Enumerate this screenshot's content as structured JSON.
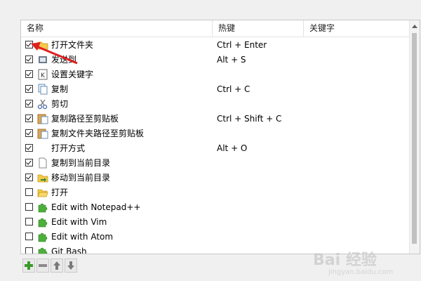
{
  "table": {
    "columns": [
      "名称",
      "热键",
      "关键字"
    ],
    "rows": [
      {
        "name": "打开文件夹",
        "hotkey": "Ctrl + Enter",
        "checked": true,
        "icon": "folder-icon"
      },
      {
        "name": "发送到",
        "hotkey": "Alt + S",
        "checked": true,
        "icon": "send-to-icon"
      },
      {
        "name": "设置关键字",
        "hotkey": "",
        "checked": true,
        "icon": "keyword-icon"
      },
      {
        "name": "复制",
        "hotkey": "Ctrl + C",
        "checked": true,
        "icon": "copy-icon"
      },
      {
        "name": "剪切",
        "hotkey": "",
        "checked": true,
        "icon": "scissors-icon"
      },
      {
        "name": "复制路径至剪贴板",
        "hotkey": "Ctrl + Shift + C",
        "checked": true,
        "icon": "clipboard-icon"
      },
      {
        "name": "复制文件夹路径至剪贴板",
        "hotkey": "",
        "checked": true,
        "icon": "clipboard-icon"
      },
      {
        "name": "打开方式",
        "hotkey": "Alt + O",
        "checked": true,
        "icon": ""
      },
      {
        "name": "复制到当前目录",
        "hotkey": "",
        "checked": true,
        "icon": "file-icon"
      },
      {
        "name": "移动到当前目录",
        "hotkey": "",
        "checked": true,
        "icon": "move-folder-icon"
      },
      {
        "name": "打开",
        "hotkey": "",
        "checked": false,
        "icon": "open-folder-icon"
      },
      {
        "name": "Edit with Notepad++",
        "hotkey": "",
        "checked": false,
        "icon": "puzzle-icon"
      },
      {
        "name": "Edit with Vim",
        "hotkey": "",
        "checked": false,
        "icon": "puzzle-icon"
      },
      {
        "name": "Edit with Atom",
        "hotkey": "",
        "checked": false,
        "icon": "puzzle-icon"
      },
      {
        "name": "Git Bash",
        "hotkey": "",
        "checked": false,
        "icon": "puzzle-icon"
      }
    ]
  },
  "toolbar": {
    "buttons": [
      "add-icon",
      "remove-icon",
      "move-up-icon",
      "move-down-icon"
    ]
  },
  "annotation": {
    "arrow_color": "#e02020"
  },
  "watermark": {
    "line1": "Bai 经验",
    "line2": "jingyan.baidu.com"
  }
}
